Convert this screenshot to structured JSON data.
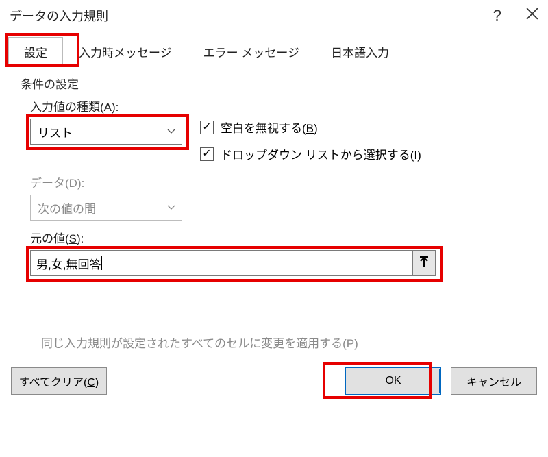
{
  "title": "データの入力規則",
  "tabs": {
    "settings": "設定",
    "input_msg": "入力時メッセージ",
    "error_msg": "エラー メッセージ",
    "ime": "日本語入力"
  },
  "section": "条件の設定",
  "labels": {
    "allow_pre": "入力値の種類(",
    "allow_key": "A",
    "allow_post": "):",
    "data_pre": "データ(",
    "data_key": "D",
    "data_post": "):",
    "source_pre": "元の値(",
    "source_key": "S",
    "source_post": "):"
  },
  "combo": {
    "allow_value": "リスト",
    "data_value": "次の値の間"
  },
  "check": {
    "ignore_blank_pre": "空白を無視する(",
    "ignore_blank_key": "B",
    "ignore_blank_post": ")",
    "dropdown_pre": "ドロップダウン リストから選択する(",
    "dropdown_key": "I",
    "dropdown_post": ")",
    "mark": "✓"
  },
  "source_value": "男,女,無回答",
  "apply_pre": "同じ入力規則が設定されたすべてのセルに変更を適用する(",
  "apply_key": "P",
  "apply_post": ")",
  "buttons": {
    "clear_pre": "すべてクリア(",
    "clear_key": "C",
    "clear_post": ")",
    "ok": "OK",
    "cancel": "キャンセル"
  }
}
